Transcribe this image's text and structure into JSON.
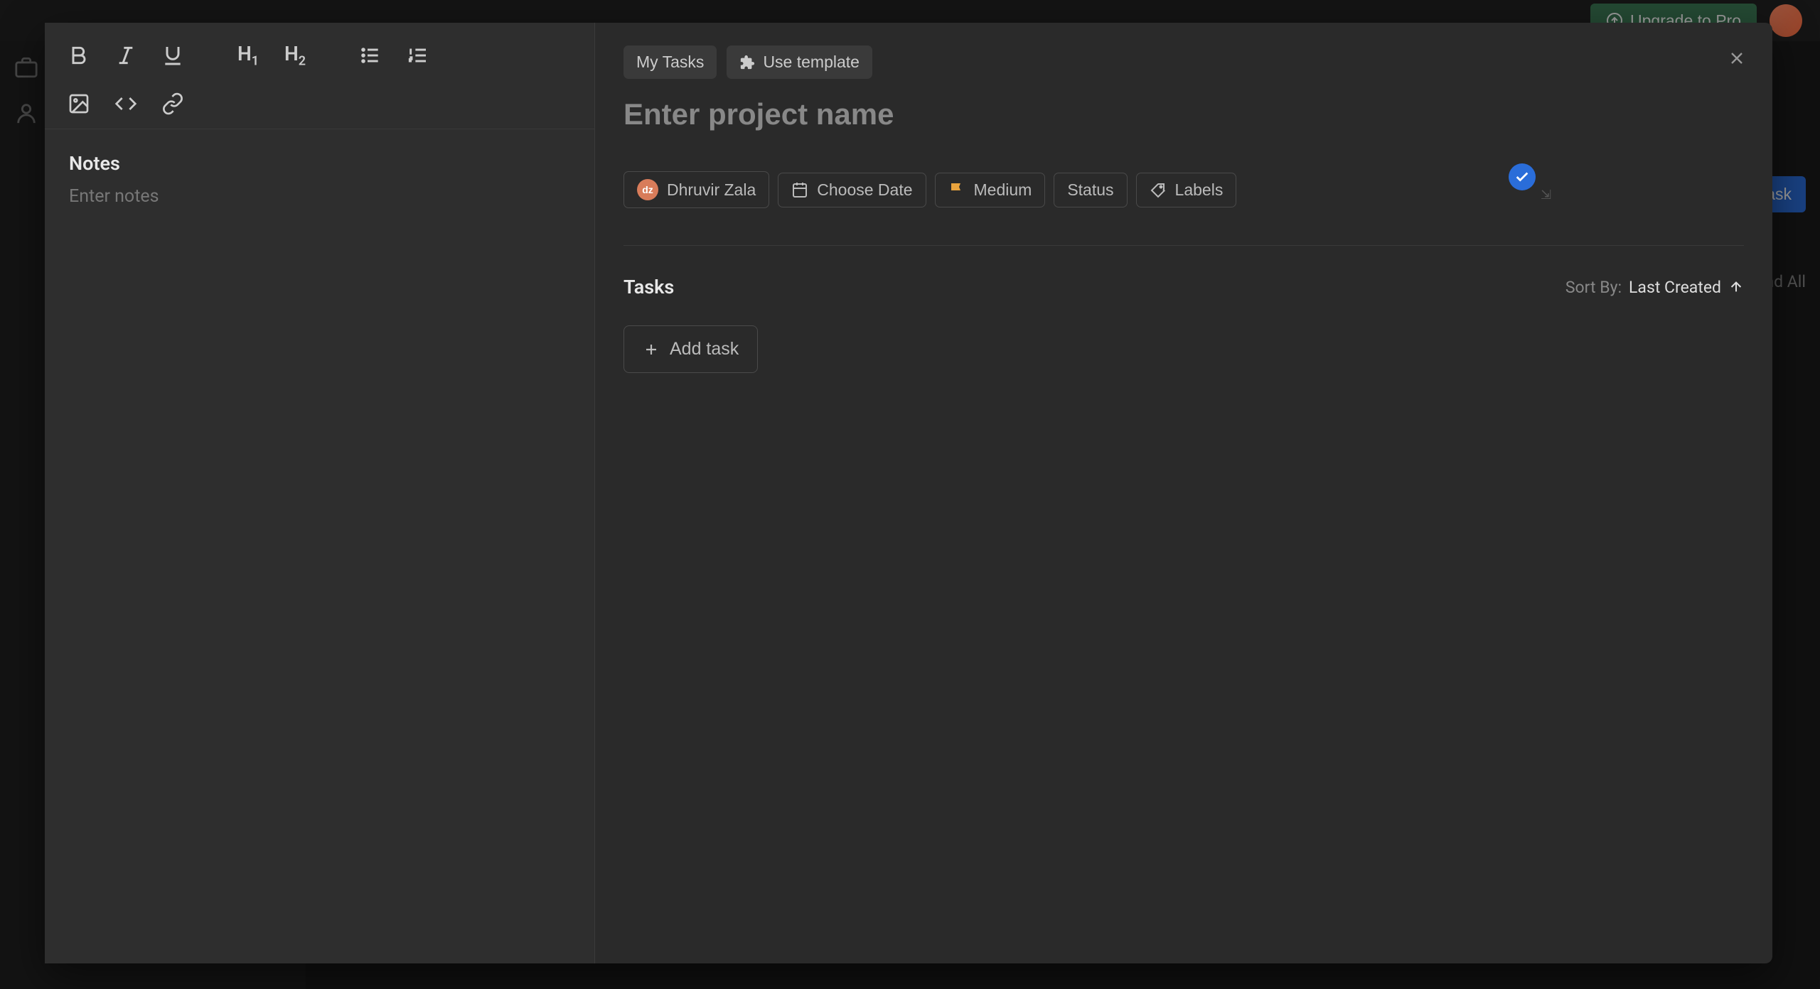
{
  "background": {
    "upgrade_button": "Upgrade to Pro",
    "new_task_button": "New Task",
    "expand_all": "Expand All"
  },
  "modal": {
    "breadcrumb": "My Tasks",
    "use_template": "Use template",
    "project_name_placeholder": "Enter project name",
    "properties": {
      "assignee": "Dhruvir Zala",
      "assignee_initials": "dz",
      "date": "Choose Date",
      "priority": "Medium",
      "status": "Status",
      "labels": "Labels"
    },
    "tasks": {
      "title": "Tasks",
      "sort_by_label": "Sort By:",
      "sort_by_value": "Last Created",
      "add_task": "Add task"
    },
    "notes": {
      "title": "Notes",
      "placeholder": "Enter notes"
    }
  }
}
